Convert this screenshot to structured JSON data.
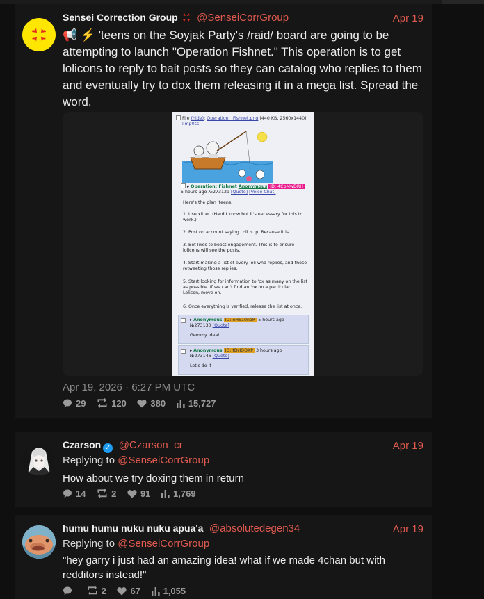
{
  "tweets": [
    {
      "name": "Sensei Correction Group",
      "badge": "💢",
      "handle": "@SenseiCorrGroup",
      "date": "Apr 19",
      "content": "📢 ⚡ 'teens on the Soyjak Party's /raid/ board are going to be attempting to launch \"Operation Fishnet.\" This operation is to get lolicons to reply to bait posts so they can catalog who replies to them and eventually try to dox them releasing it in a mega list. Spread the word.",
      "timestamp": "Apr 19, 2026 · 6:27 PM UTC",
      "stats": {
        "replies": "29",
        "retweets": "120",
        "likes": "380",
        "views": "15,727"
      },
      "media": {
        "file_label": "File",
        "file_hide": "(hide)",
        "file_name": "Operation__Fishnet.png",
        "file_info": "(440 KB, 2560x1440)",
        "file_name2": "limp0ss",
        "op_title": "Operation: Fishnet",
        "op_name": "Anonymous",
        "op_id": "ID: 4CpMwDRH",
        "op_time": "5 hours ago",
        "op_no": "№273129",
        "op_quote": "[Quote]",
        "op_voice": "[Voice Chat]",
        "op_body": [
          "Here's the plan 'teens.",
          "1. Use xitter. (Hard I know but it's necessary for this to work.)",
          "2. Post on account saying Loli is 'p. Because it is.",
          "3. Bot likes to boost engagement. This is to ensure lolicons will see the posts.",
          "4. Start making a list of every loli who replies, and those retweeting those replies.",
          "5. Start looking for information to 'ox as many on the list as possible. If we can't find an 'ox on a particular Lolicon, move on.",
          "6. Once everything is verified, release the list at once."
        ],
        "replies": [
          {
            "name": "Anonymous",
            "id": "ID: oHS10naR",
            "time": "5 hours ago",
            "no": "№273130",
            "quote": "[Quote]",
            "text": "Gemmy idea!"
          },
          {
            "name": "Anonymous",
            "id": "ID: tDrIOOKP",
            "time": "3 hours ago",
            "no": "№273146",
            "quote": "[Quote]",
            "text": "Let's do it"
          }
        ]
      }
    },
    {
      "name": "Czarson",
      "handle": "@Czarson_cr",
      "date": "Apr 19",
      "reply_prefix": "Replying to",
      "reply_to": "@SenseiCorrGroup",
      "content": "How about we try doxing them in return",
      "stats": {
        "replies": "14",
        "retweets": "2",
        "likes": "91",
        "views": "1,769"
      }
    },
    {
      "name": "humu humu nuku nuku apua'a",
      "handle": "@absolutedegen34",
      "date": "Apr 19",
      "reply_prefix": "Replying to",
      "reply_to": "@SenseiCorrGroup",
      "content": "\"hey garry i just had an amazing idea! what if we made 4chan but with redditors instead!\"",
      "stats": {
        "replies": "",
        "retweets": "2",
        "likes": "67",
        "views": "1,055"
      }
    }
  ],
  "colors": {
    "accent": "#e05a4f",
    "background": "#0f0f0f",
    "card": "#161616",
    "muted": "#8a8a8a"
  }
}
